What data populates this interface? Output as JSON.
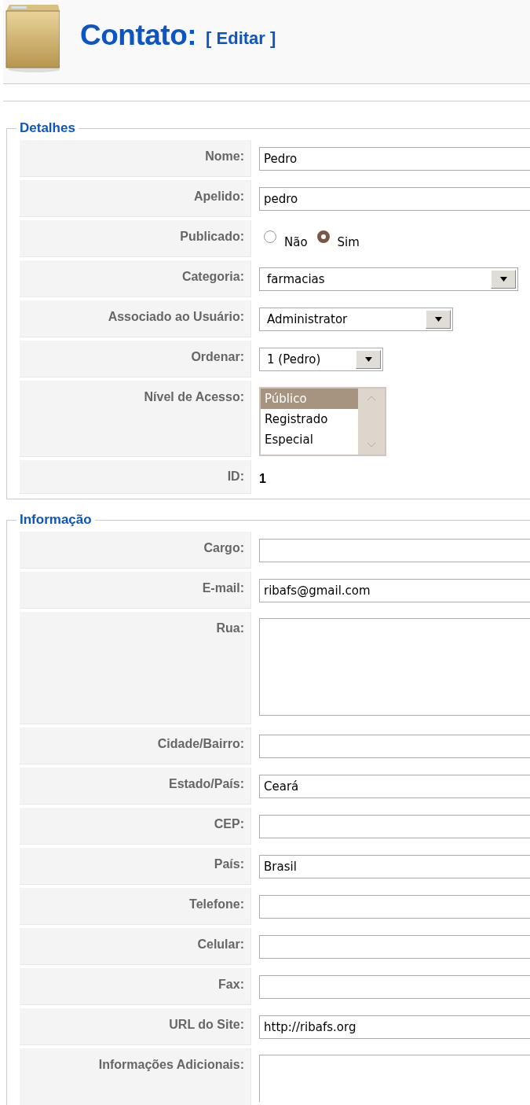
{
  "header": {
    "title": "Contato:",
    "action": "[ Editar ]"
  },
  "sections": [
    {
      "legend": "Detalhes",
      "rows": [
        {
          "kind": "text",
          "label": "Nome:",
          "value": "Pedro"
        },
        {
          "kind": "text",
          "label": "Apelido:",
          "value": "pedro"
        },
        {
          "kind": "radio",
          "label": "Publicado:",
          "options": [
            {
              "label": "Não",
              "selected": false
            },
            {
              "label": "Sim",
              "selected": true
            }
          ]
        },
        {
          "kind": "select",
          "label": "Categoria:",
          "value": "farmacias"
        },
        {
          "kind": "select",
          "label": "Associado ao Usuário:",
          "value": "Administrator"
        },
        {
          "kind": "select",
          "label": "Ordenar:",
          "value": "1 (Pedro)"
        },
        {
          "kind": "listbox",
          "label": "Nível de Acesso:",
          "options": [
            {
              "label": "Público",
              "selected": true
            },
            {
              "label": "Registrado",
              "selected": false
            },
            {
              "label": "Especial",
              "selected": false
            }
          ]
        },
        {
          "kind": "static",
          "label": "ID:",
          "value": "1"
        }
      ]
    },
    {
      "legend": "Informação",
      "rows": [
        {
          "kind": "text",
          "label": "Cargo:",
          "value": ""
        },
        {
          "kind": "text",
          "label": "E-mail:",
          "value": "ribafs@gmail.com"
        },
        {
          "kind": "textarea",
          "label": "Rua:",
          "value": ""
        },
        {
          "kind": "text",
          "label": "Cidade/Bairro:",
          "value": ""
        },
        {
          "kind": "text",
          "label": "Estado/País:",
          "value": "Ceará"
        },
        {
          "kind": "text",
          "label": "CEP:",
          "value": ""
        },
        {
          "kind": "text",
          "label": "País:",
          "value": "Brasil"
        },
        {
          "kind": "text",
          "label": "Telefone:",
          "value": ""
        },
        {
          "kind": "text",
          "label": "Celular:",
          "value": ""
        },
        {
          "kind": "text",
          "label": "Fax:",
          "value": ""
        },
        {
          "kind": "text",
          "label": "URL do Site:",
          "value": "http://ribafs.org"
        },
        {
          "kind": "textarea-cut",
          "label": "Informações Adicionais:",
          "value": ""
        }
      ]
    }
  ]
}
